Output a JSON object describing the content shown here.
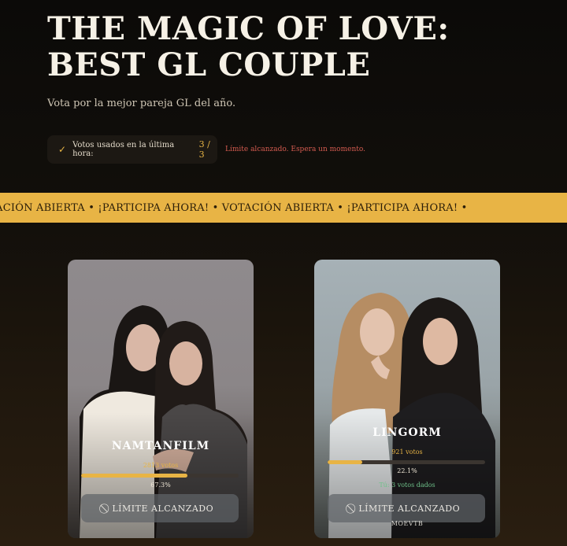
{
  "header": {
    "title": "THE MAGIC OF LOVE:\nBEST GL COUPLE",
    "subtitle": "Vota por la mejor pareja GL del año."
  },
  "vote_counter": {
    "label": "Votos usados en la última hora:",
    "value": "3 / 3",
    "limit_message": "Límite alcanzado. Espera un momento.",
    "icon": "check-icon"
  },
  "ticker": {
    "text": "TACIÓN ABIERTA • ¡PARTICIPA AHORA! • VOTACIÓN ABIERTA • ¡PARTICIPA AHORA! •"
  },
  "candidates": [
    {
      "name": "NAMTANFILM",
      "votes": "2813 votos",
      "percent": "67.3%",
      "progress": 0.673,
      "button_label": "LÍMITE ALCANZADO",
      "button_icon": "ban-icon"
    },
    {
      "name": "LINGORM",
      "votes": "921 votos",
      "percent": "22.1%",
      "progress": 0.221,
      "your_votes": "Tú: 3 votos dados",
      "button_label": "LÍMITE ALCANZADO",
      "button_icon": "ban-icon",
      "footer": "MOEVTB"
    }
  ],
  "colors": {
    "accent": "#e8b445",
    "warning": "#d45b50",
    "success": "#6fc28a",
    "background": "#0b0a08"
  }
}
